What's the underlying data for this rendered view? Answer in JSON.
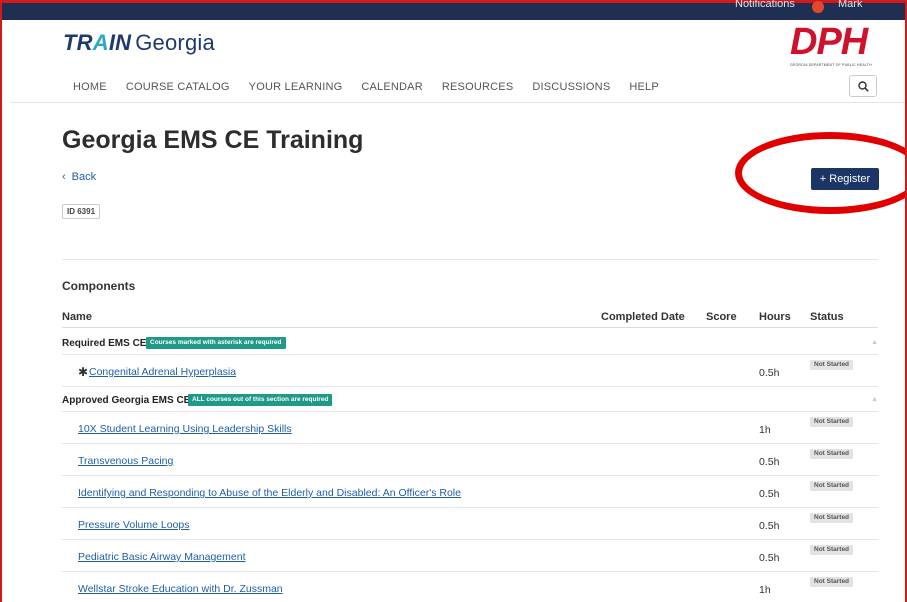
{
  "topbar": {
    "notifications": "Notifications",
    "user": "Mark"
  },
  "logo": {
    "train_a": "TR",
    "train_b": "A",
    "train_c": "IN",
    "place": "Georgia"
  },
  "dph": {
    "letters": "DPH",
    "subtitle": "GEORGIA DEPARTMENT OF PUBLIC HEALTH"
  },
  "nav": [
    "HOME",
    "COURSE CATALOG",
    "YOUR LEARNING",
    "CALENDAR",
    "RESOURCES",
    "DISCUSSIONS",
    "HELP"
  ],
  "page": {
    "title": "Georgia EMS CE Training",
    "back": "Back",
    "id": "ID 6391",
    "register": "+ Register"
  },
  "components": {
    "title": "Components",
    "headers": {
      "name": "Name",
      "completed": "Completed Date",
      "score": "Score",
      "hours": "Hours",
      "status": "Status"
    },
    "sections": [
      {
        "title": "Required EMS CE",
        "tag": "Courses marked with asterisk are required",
        "items": [
          {
            "star": "✱",
            "name": "Congenital Adrenal Hyperplasia",
            "hours": "0.5h",
            "status": "Not Started"
          }
        ]
      },
      {
        "title": "Approved Georgia EMS CE",
        "tag": "ALL courses out of this section are required",
        "items": [
          {
            "name": "10X Student Learning Using Leadership Skills",
            "hours": "1h",
            "status": "Not Started"
          },
          {
            "name": "Transvenous Pacing",
            "hours": "0.5h",
            "status": "Not Started"
          },
          {
            "name": "Identifying and Responding to Abuse of the Elderly and Disabled: An Officer's Role",
            "hours": "0.5h",
            "status": "Not Started"
          },
          {
            "name": "Pressure Volume Loops",
            "hours": "0.5h",
            "status": "Not Started"
          },
          {
            "name": "Pediatric Basic Airway Management",
            "hours": "0.5h",
            "status": "Not Started"
          },
          {
            "name": "Wellstar Stroke Education with Dr. Zussman",
            "hours": "1h",
            "status": "Not Started"
          }
        ]
      }
    ]
  },
  "colors": {
    "brand_navy": "#1a3566",
    "accent_teal": "#1f9a87",
    "dph_red": "#d0112b",
    "annotation_red": "#e00000"
  }
}
